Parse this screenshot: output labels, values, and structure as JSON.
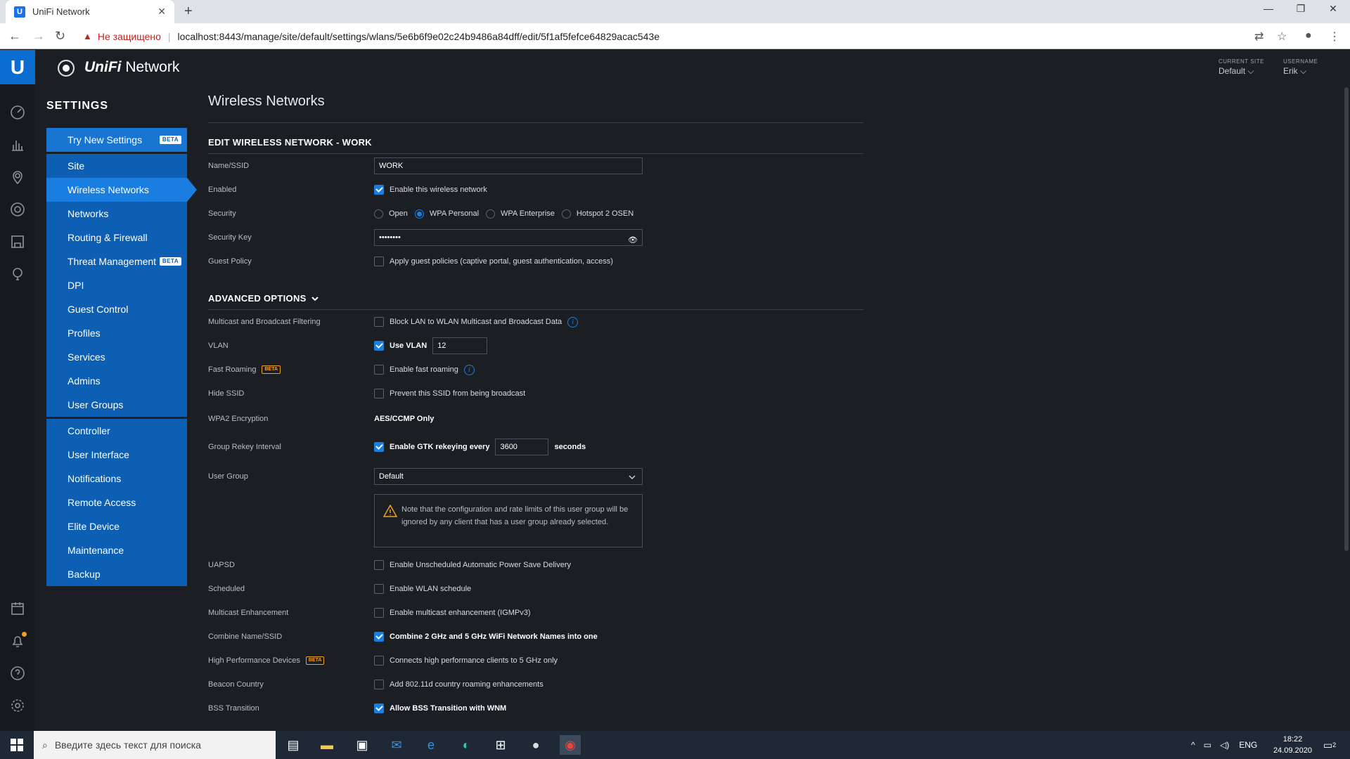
{
  "browser": {
    "tab_title": "UniFi Network",
    "tab_favicon": "U",
    "new_tab": "+",
    "insecure_label": "Не защищено",
    "url": "localhost:8443/manage/site/default/settings/wlans/5e6b6f9e02c24b9486a84dff/edit/5f1af5fefce64829acac543e"
  },
  "header": {
    "app_name_brand": "UniFi",
    "app_name_rest": " Network",
    "current_site_label": "CURRENT SITE",
    "current_site_value": "Default",
    "username_label": "USERNAME",
    "username_value": "Erik"
  },
  "sidebar": {
    "heading": "SETTINGS",
    "try_new": "Try New Settings",
    "beta": "BETA",
    "items_group1": [
      "Site",
      "Wireless Networks",
      "Networks",
      "Routing & Firewall",
      "Threat Management",
      "DPI",
      "Guest Control",
      "Profiles",
      "Services",
      "Admins",
      "User Groups"
    ],
    "items_group2": [
      "Controller",
      "User Interface",
      "Notifications",
      "Remote Access",
      "Elite Device",
      "Maintenance",
      "Backup"
    ]
  },
  "main": {
    "page_title": "Wireless Networks",
    "edit_title": "EDIT WIRELESS NETWORK - WORK",
    "name_label": "Name/SSID",
    "name_value": "WORK",
    "enabled_label": "Enabled",
    "enabled_text": "Enable this wireless network",
    "security_label": "Security",
    "security_options": [
      "Open",
      "WPA Personal",
      "WPA Enterprise",
      "Hotspot 2 OSEN"
    ],
    "security_key_label": "Security Key",
    "security_key_value": "••••••••",
    "guest_label": "Guest Policy",
    "guest_text": "Apply guest policies (captive portal, guest authentication, access)",
    "advanced_title": "ADVANCED OPTIONS",
    "multicast_label": "Multicast and Broadcast Filtering",
    "multicast_text": "Block LAN to WLAN Multicast and Broadcast Data",
    "vlan_label": "VLAN",
    "vlan_text": "Use VLAN",
    "vlan_value": "12",
    "fast_roaming_label": "Fast Roaming",
    "fast_roaming_text": "Enable fast roaming",
    "hide_ssid_label": "Hide SSID",
    "hide_ssid_text": "Prevent this SSID from being broadcast",
    "wpa2_label": "WPA2 Encryption",
    "wpa2_value": "AES/CCMP Only",
    "rekey_label": "Group Rekey Interval",
    "rekey_text": "Enable GTK rekeying every",
    "rekey_value": "3600",
    "rekey_unit": "seconds",
    "user_group_label": "User Group",
    "user_group_value": "Default",
    "user_group_note": "Note that the configuration and rate limits of this user group will be ignored by any client that has a user group already selected.",
    "uapsd_label": "UAPSD",
    "uapsd_text": "Enable Unscheduled Automatic Power Save Delivery",
    "scheduled_label": "Scheduled",
    "scheduled_text": "Enable WLAN schedule",
    "mc_enh_label": "Multicast Enhancement",
    "mc_enh_text": "Enable multicast enhancement (IGMPv3)",
    "combine_label": "Combine Name/SSID",
    "combine_text": "Combine 2 GHz and 5 GHz WiFi Network Names into one",
    "hpd_label": "High Performance Devices",
    "hpd_text": "Connects high performance clients to 5 GHz only",
    "beacon_label": "Beacon Country",
    "beacon_text": "Add 802.11d country roaming enhancements",
    "bss_label": "BSS Transition",
    "bss_text": "Allow BSS Transition with WNM"
  },
  "taskbar": {
    "search_placeholder": "Введите здесь текст для поиска",
    "lang": "ENG",
    "time": "18:22",
    "date": "24.09.2020",
    "notif_count": "2"
  }
}
